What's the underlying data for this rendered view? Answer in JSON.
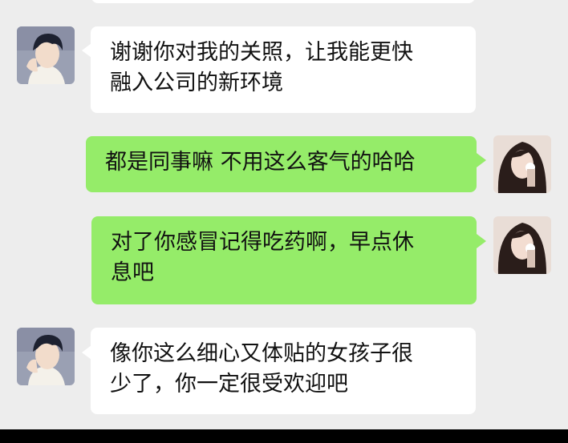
{
  "messages": [
    {
      "sender": "other",
      "lines": [
        "谢谢你对我的关照，让我能更快",
        "融入公司的新环境"
      ]
    },
    {
      "sender": "self",
      "lines": [
        "都是同事嘛 不用这么客气的哈哈"
      ]
    },
    {
      "sender": "self",
      "lines": [
        "对了你感冒记得吃药啊，早点休",
        "息吧"
      ]
    },
    {
      "sender": "other",
      "lines": [
        "像你这么细心又体贴的女孩子很",
        "少了，你一定很受欢迎吧"
      ]
    }
  ],
  "colors": {
    "background": "#ededed",
    "incoming_bubble": "#ffffff",
    "outgoing_bubble": "#95ec69",
    "text": "#111111"
  },
  "icons": {
    "other_avatar": "male-avatar-icon",
    "self_avatar": "female-avatar-icon"
  }
}
